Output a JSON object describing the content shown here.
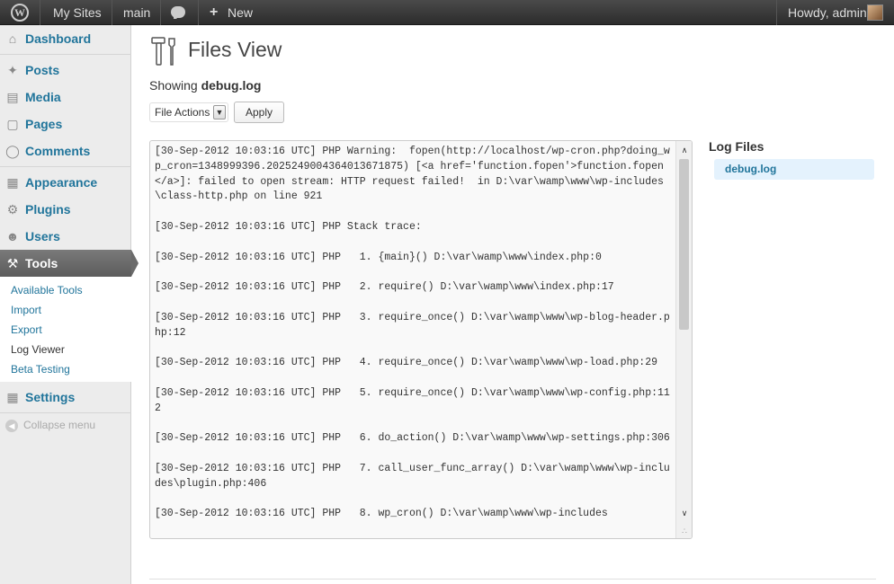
{
  "admin_bar": {
    "my_sites": "My Sites",
    "site_name": "main",
    "new_label": "New",
    "new_icon": "+",
    "howdy": "Howdy, admin"
  },
  "sidebar": {
    "items": [
      {
        "label": "Dashboard",
        "icon": "dashboard-icon"
      },
      {
        "label": "Posts",
        "icon": "pin-icon"
      },
      {
        "label": "Media",
        "icon": "media-icon"
      },
      {
        "label": "Pages",
        "icon": "pages-icon"
      },
      {
        "label": "Comments",
        "icon": "comment-icon"
      },
      {
        "label": "Appearance",
        "icon": "appearance-icon"
      },
      {
        "label": "Plugins",
        "icon": "plugin-icon"
      },
      {
        "label": "Users",
        "icon": "users-icon"
      },
      {
        "label": "Tools",
        "icon": "tools-icon"
      },
      {
        "label": "Settings",
        "icon": "settings-icon"
      }
    ],
    "submenu": [
      "Available Tools",
      "Import",
      "Export",
      "Log Viewer",
      "Beta Testing"
    ],
    "collapse": "Collapse menu",
    "active": "Tools",
    "active_submenu": "Log Viewer"
  },
  "page": {
    "title": "Files View",
    "showing_prefix": "Showing ",
    "showing_file": "debug.log",
    "file_actions": "File Actions",
    "apply": "Apply",
    "log_content": "[30-Sep-2012 10:03:16 UTC] PHP Warning:  fopen(http://localhost/wp-cron.php?doing_wp_cron=1348999396.2025249004364013671875) [<a href='function.fopen'>function.fopen</a>]: failed to open stream: HTTP request failed!  in D:\\var\\wamp\\www\\wp-includes\\class-http.php on line 921\n\n[30-Sep-2012 10:03:16 UTC] PHP Stack trace:\n\n[30-Sep-2012 10:03:16 UTC] PHP   1. {main}() D:\\var\\wamp\\www\\index.php:0\n\n[30-Sep-2012 10:03:16 UTC] PHP   2. require() D:\\var\\wamp\\www\\index.php:17\n\n[30-Sep-2012 10:03:16 UTC] PHP   3. require_once() D:\\var\\wamp\\www\\wp-blog-header.php:12\n\n[30-Sep-2012 10:03:16 UTC] PHP   4. require_once() D:\\var\\wamp\\www\\wp-load.php:29\n\n[30-Sep-2012 10:03:16 UTC] PHP   5. require_once() D:\\var\\wamp\\www\\wp-config.php:112\n\n[30-Sep-2012 10:03:16 UTC] PHP   6. do_action() D:\\var\\wamp\\www\\wp-settings.php:306\n\n[30-Sep-2012 10:03:16 UTC] PHP   7. call_user_func_array() D:\\var\\wamp\\www\\wp-includes\\plugin.php:406\n\n[30-Sep-2012 10:03:16 UTC] PHP   8. wp_cron() D:\\var\\wamp\\www\\wp-includes",
    "log_files_title": "Log Files",
    "log_files": [
      "debug.log"
    ]
  },
  "colors": {
    "link": "#21759b",
    "admin_bar": "#333333",
    "active_menu": "#6b6b6b",
    "selected_file_bg": "#e4f2fd"
  }
}
